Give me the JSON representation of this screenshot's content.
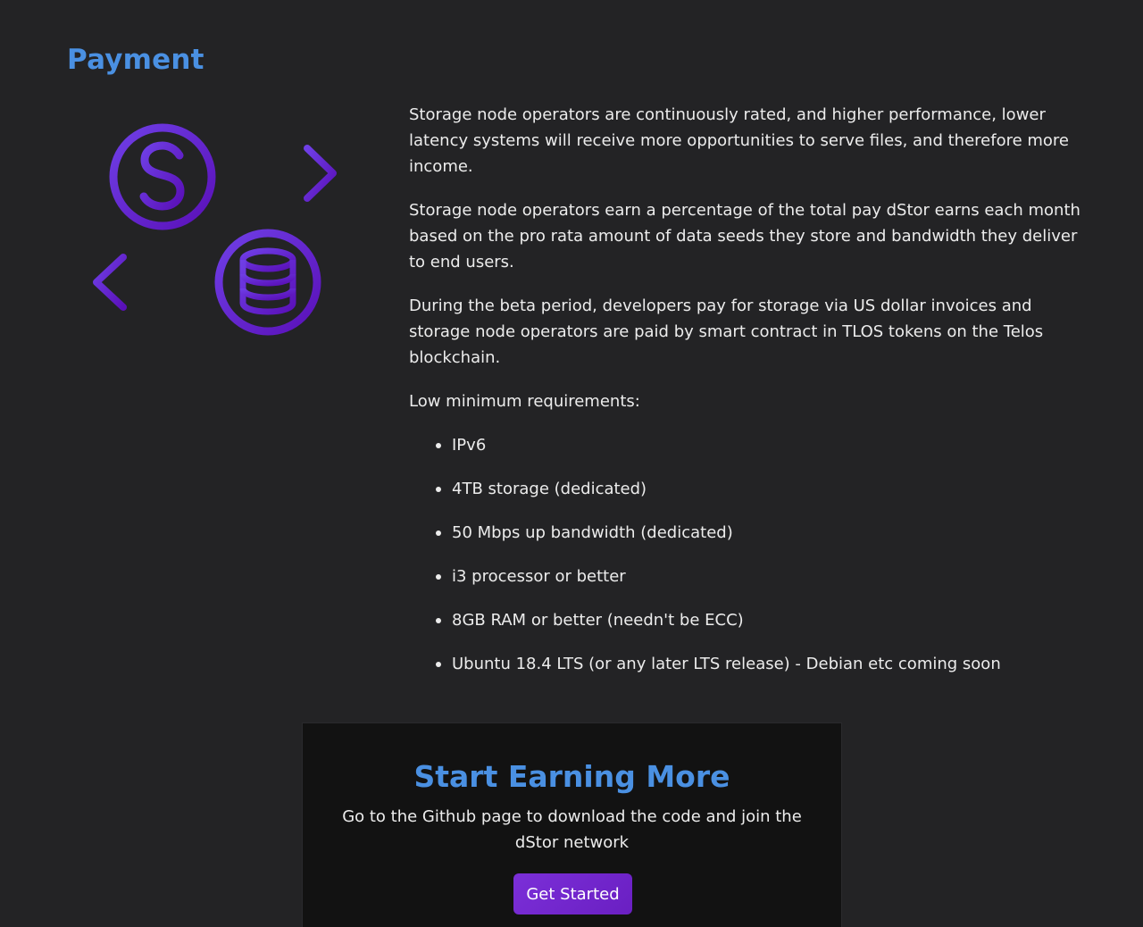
{
  "section": {
    "title": "Payment"
  },
  "illustration": {
    "icons": [
      "dollar-circle-icon",
      "arrow-right-icon",
      "arrow-left-icon",
      "database-circle-icon"
    ],
    "colors": {
      "start": "#6f3fe6",
      "end": "#5a10b8"
    }
  },
  "content": {
    "paragraphs": [
      "Storage node operators are continuously rated, and higher performance, lower latency systems will receive more opportunities to serve files, and therefore more income.",
      "Storage node operators earn a percentage of the total pay dStor earns each month based on the pro rata amount of data seeds they store and bandwidth they deliver to end users.",
      "During the beta period, developers pay for storage via US dollar invoices and storage node operators are paid by smart contract in TLOS tokens on the Telos blockchain.",
      "Low minimum requirements:"
    ],
    "requirements": [
      "IPv6",
      "4TB storage (dedicated)",
      "50 Mbps up bandwidth (dedicated)",
      "i3 processor or better",
      "8GB RAM or better (needn't be ECC)",
      "Ubuntu 18.4 LTS (or any later LTS release) - Debian etc coming soon"
    ]
  },
  "cta": {
    "title": "Start Earning More",
    "text": "Go to the Github page to download the code and join the dStor network",
    "button_label": "Get Started"
  },
  "colors": {
    "background": "#232325",
    "accent_blue": "#4a90e2",
    "cta_background": "#121212",
    "button_purple": "#7b2fd8"
  }
}
